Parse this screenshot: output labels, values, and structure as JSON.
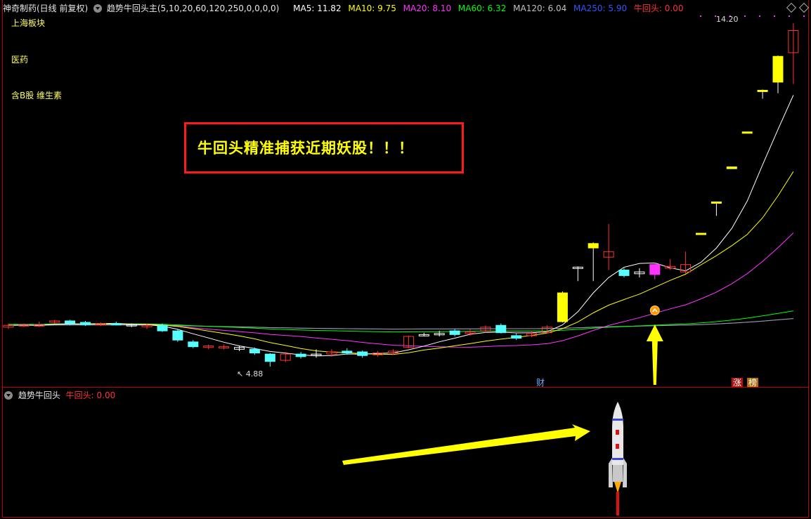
{
  "header": {
    "stock_name": "神奇制药(日线 前复权)",
    "indicator_name": "趋势牛回头主(5,10,20,60,120,250,0,0,0,0)",
    "ma_values": [
      {
        "label": "MA5: 11.82",
        "color": "#ffffff"
      },
      {
        "label": "MA10: 9.75",
        "color": "#ffff00"
      },
      {
        "label": "MA20: 8.10",
        "color": "#ff33ff"
      },
      {
        "label": "MA60: 6.32",
        "color": "#00ff00"
      },
      {
        "label": "MA120: 6.04",
        "color": "#c0c0c0"
      },
      {
        "label": "MA250: 5.90",
        "color": "#3355ff"
      },
      {
        "label": "牛回头: 0.00",
        "color": "#ff3333"
      }
    ]
  },
  "sidebar_labels": [
    "上海板块",
    "医药",
    "含B股 维生素"
  ],
  "callout_text": "牛回头精准捕获近期妖股！！！",
  "price_labels": {
    "high": "14.20",
    "low": "4.88"
  },
  "event_tags": {
    "finance": "财",
    "rise": "涨",
    "list": "榜"
  },
  "sub_panel": {
    "indicator_name": "趋势牛回头",
    "value_label": "牛回头: 0.00"
  },
  "colors": {
    "rise": "#ff3333",
    "fall": "#55ffff",
    "signal": "#ff33ff",
    "limit_up": "#ffff00",
    "arrow": "#ffff00",
    "frame": "#c00000"
  },
  "chart_data": {
    "type": "candlestick",
    "y_range": [
      4.88,
      14.2
    ],
    "candles": [
      {
        "o": 5.95,
        "c": 6.0,
        "h": 6.05,
        "l": 5.9,
        "kind": "up"
      },
      {
        "o": 5.98,
        "c": 6.02,
        "h": 6.05,
        "l": 5.95,
        "kind": "up"
      },
      {
        "o": 6.02,
        "c": 5.98,
        "h": 6.1,
        "l": 5.95,
        "kind": "up"
      },
      {
        "o": 6.1,
        "c": 6.12,
        "h": 6.15,
        "l": 6.05,
        "kind": "up"
      },
      {
        "o": 6.12,
        "c": 6.05,
        "h": 6.15,
        "l": 6.0,
        "kind": "down"
      },
      {
        "o": 6.08,
        "c": 6.02,
        "h": 6.12,
        "l": 5.98,
        "kind": "down"
      },
      {
        "o": 6.02,
        "c": 6.05,
        "h": 6.08,
        "l": 5.98,
        "kind": "up"
      },
      {
        "o": 6.05,
        "c": 6.03,
        "h": 6.1,
        "l": 6.0,
        "kind": "down"
      },
      {
        "o": 6.02,
        "c": 6.0,
        "h": 6.05,
        "l": 5.95,
        "kind": "doji"
      },
      {
        "o": 6.0,
        "c": 5.98,
        "h": 6.05,
        "l": 5.9,
        "kind": "up"
      },
      {
        "o": 6.0,
        "c": 5.85,
        "h": 6.05,
        "l": 5.82,
        "kind": "down"
      },
      {
        "o": 5.85,
        "c": 5.6,
        "h": 5.88,
        "l": 5.55,
        "kind": "down"
      },
      {
        "o": 5.55,
        "c": 5.42,
        "h": 5.6,
        "l": 5.38,
        "kind": "down"
      },
      {
        "o": 5.4,
        "c": 5.44,
        "h": 5.48,
        "l": 5.35,
        "kind": "up"
      },
      {
        "o": 5.42,
        "c": 5.4,
        "h": 5.48,
        "l": 5.35,
        "kind": "up"
      },
      {
        "o": 5.4,
        "c": 5.35,
        "h": 5.45,
        "l": 5.3,
        "kind": "doji"
      },
      {
        "o": 5.35,
        "c": 5.25,
        "h": 5.4,
        "l": 5.2,
        "kind": "down"
      },
      {
        "o": 5.22,
        "c": 5.02,
        "h": 5.25,
        "l": 4.88,
        "kind": "down"
      },
      {
        "o": 5.05,
        "c": 5.22,
        "h": 5.28,
        "l": 5.0,
        "kind": "up"
      },
      {
        "o": 5.22,
        "c": 5.15,
        "h": 5.28,
        "l": 5.1,
        "kind": "down"
      },
      {
        "o": 5.2,
        "c": 5.22,
        "h": 5.35,
        "l": 5.12,
        "kind": "doji"
      },
      {
        "o": 5.22,
        "c": 5.28,
        "h": 5.35,
        "l": 5.15,
        "kind": "up"
      },
      {
        "o": 5.3,
        "c": 5.25,
        "h": 5.38,
        "l": 5.2,
        "kind": "down"
      },
      {
        "o": 5.28,
        "c": 5.18,
        "h": 5.32,
        "l": 5.12,
        "kind": "down"
      },
      {
        "o": 5.2,
        "c": 5.25,
        "h": 5.3,
        "l": 5.15,
        "kind": "up"
      },
      {
        "o": 5.25,
        "c": 5.3,
        "h": 5.35,
        "l": 5.2,
        "kind": "up"
      },
      {
        "o": 5.4,
        "c": 5.7,
        "h": 5.72,
        "l": 5.38,
        "kind": "up"
      },
      {
        "o": 5.72,
        "c": 5.75,
        "h": 5.8,
        "l": 5.7,
        "kind": "doji"
      },
      {
        "o": 5.78,
        "c": 5.76,
        "h": 5.85,
        "l": 5.7,
        "kind": "doji"
      },
      {
        "o": 5.85,
        "c": 5.75,
        "h": 5.9,
        "l": 5.7,
        "kind": "down"
      },
      {
        "o": 5.78,
        "c": 5.82,
        "h": 5.9,
        "l": 5.72,
        "kind": "up"
      },
      {
        "o": 5.85,
        "c": 5.95,
        "h": 6.0,
        "l": 5.8,
        "kind": "up"
      },
      {
        "o": 6.0,
        "c": 5.8,
        "h": 6.05,
        "l": 5.78,
        "kind": "down"
      },
      {
        "o": 5.72,
        "c": 5.65,
        "h": 5.78,
        "l": 5.6,
        "kind": "down"
      },
      {
        "o": 5.72,
        "c": 5.78,
        "h": 5.85,
        "l": 5.68,
        "kind": "up"
      },
      {
        "o": 5.8,
        "c": 5.95,
        "h": 6.0,
        "l": 5.78,
        "kind": "up"
      },
      {
        "o": 6.1,
        "c": 6.88,
        "h": 6.92,
        "l": 6.08,
        "kind": "limit"
      },
      {
        "o": 7.55,
        "c": 7.58,
        "h": 7.6,
        "l": 7.2,
        "kind": "doji"
      },
      {
        "o": 8.1,
        "c": 8.22,
        "h": 8.25,
        "l": 7.2,
        "kind": "limit"
      },
      {
        "o": 8.0,
        "c": 7.85,
        "h": 8.75,
        "l": 7.5,
        "kind": "up"
      },
      {
        "o": 7.5,
        "c": 7.35,
        "h": 7.55,
        "l": 7.3,
        "kind": "down"
      },
      {
        "o": 7.45,
        "c": 7.4,
        "h": 7.55,
        "l": 7.3,
        "kind": "doji"
      },
      {
        "o": 7.38,
        "c": 7.65,
        "h": 7.7,
        "l": 7.25,
        "kind": "signal"
      },
      {
        "o": 7.6,
        "c": 7.55,
        "h": 7.8,
        "l": 7.5,
        "kind": "up"
      },
      {
        "o": 7.65,
        "c": 7.45,
        "h": 8.0,
        "l": 7.4,
        "kind": "up"
      },
      {
        "o": 8.48,
        "c": 8.5,
        "h": 8.5,
        "l": 8.48,
        "kind": "limit_flat"
      },
      {
        "o": 9.35,
        "c": 9.35,
        "h": 9.35,
        "l": 8.97,
        "kind": "limit_flat"
      },
      {
        "o": 10.25,
        "c": 10.3,
        "h": 10.3,
        "l": 10.25,
        "kind": "limit_flat"
      },
      {
        "o": 11.22,
        "c": 11.25,
        "h": 11.25,
        "l": 11.22,
        "kind": "limit_flat"
      },
      {
        "o": 12.35,
        "c": 12.38,
        "h": 12.4,
        "l": 12.15,
        "kind": "limit_flat"
      },
      {
        "o": 12.6,
        "c": 13.3,
        "h": 13.32,
        "l": 12.3,
        "kind": "limit"
      },
      {
        "o": 13.4,
        "c": 14.0,
        "h": 14.2,
        "l": 12.55,
        "kind": "up"
      }
    ]
  }
}
